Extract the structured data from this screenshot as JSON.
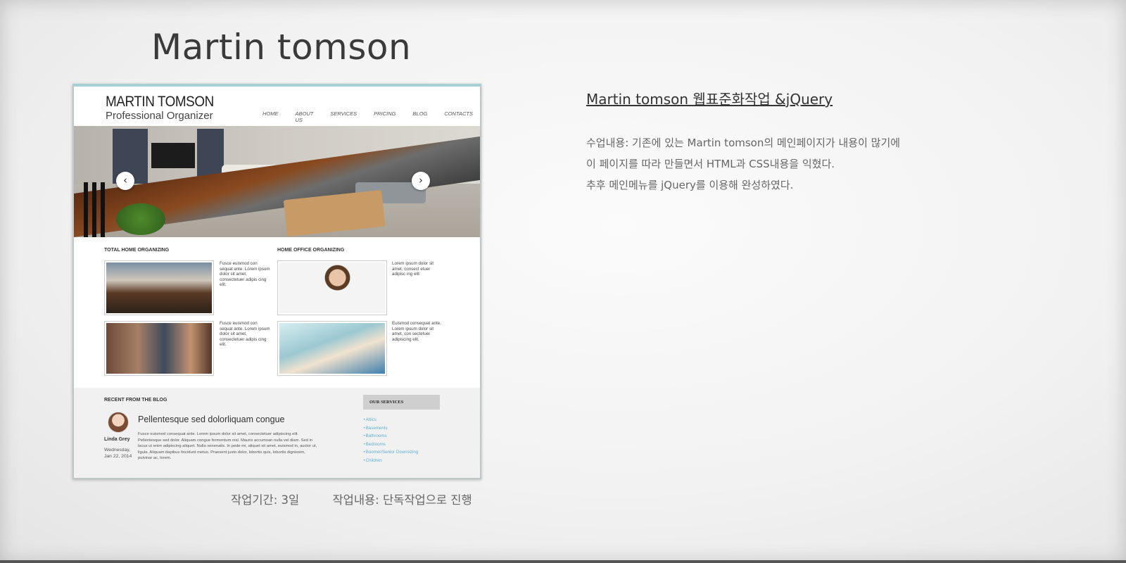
{
  "title": "Martin tomson",
  "mockup": {
    "logo_line1": "MARTIN TOMSON",
    "logo_line2": "Professional Organizer",
    "nav": [
      "HOME",
      "ABOUT US",
      "SERVICES",
      "PRICING",
      "BLOG",
      "CONTACTS"
    ],
    "hero_prev": "‹",
    "hero_next": "›",
    "section1_title": "TOTAL HOME ORGANIZING",
    "section2_title": "HOME OFFICE ORGANIZING",
    "items": [
      {
        "desc": "Fusce euismod con sequat ante. Lorem ipsum dolor sit amet, consectetuer adipis cing elit."
      },
      {
        "desc": "Lorem ipsum dolor sit amet, consect etuer adipisc ing elit"
      },
      {
        "desc": "Fusce euismod con sequat ante. Lorem ipsum dolor sit amet, consectetuer adipis cing elit."
      },
      {
        "desc": "Euismod consequat ante. Lorem ipsum dolor sit amet, con sectetuer adipiscing elit."
      }
    ],
    "blog_title": "RECENT FROM THE BLOG",
    "post_heading": "Pellentesque sed dolorliquam congue",
    "post_body": "Fusce euismod consequat ante. Lorem ipsum dolor sit amet, consectetuer adipiscing elit. Pellentesque sed dolor. Aliquam congue fermentum nisl. Mauris accumsan nulla vel diam. Sed in lacus ut enim adipiscing aliquet. Nulla venenatis. In pede mi, aliquet sit amet, euismod in, auctor ut, ligula. Aliquam dapibus tincidunt metus. Praesent justo dolor, lobortis quis, lobortis dignissim, pulvinar ac, lorem.",
    "author": "Linda Grey",
    "date": "Wednesday, Jan 22, 2014",
    "services_title": "OUR SERVICES",
    "services": [
      "Attics",
      "Basements",
      "Bathrooms",
      "Bedrooms",
      "Boomer/Senior Downsizing",
      "Children"
    ]
  },
  "project": {
    "heading": "Martin tomson 웹표준화작업 &jQuery",
    "lines": [
      "수업내용: 기존에 있는 Martin tomson의 메인페이지가 내용이 많기에",
      "이 페이지를 따라 만들면서 HTML과 CSS내용을 익혔다.",
      "추후 메인메뉴를 jQuery를 이용해 완성하였다."
    ]
  },
  "meta": {
    "period": "작업기간: 3일",
    "work": "작업내용: 단독작업으로 진행"
  }
}
